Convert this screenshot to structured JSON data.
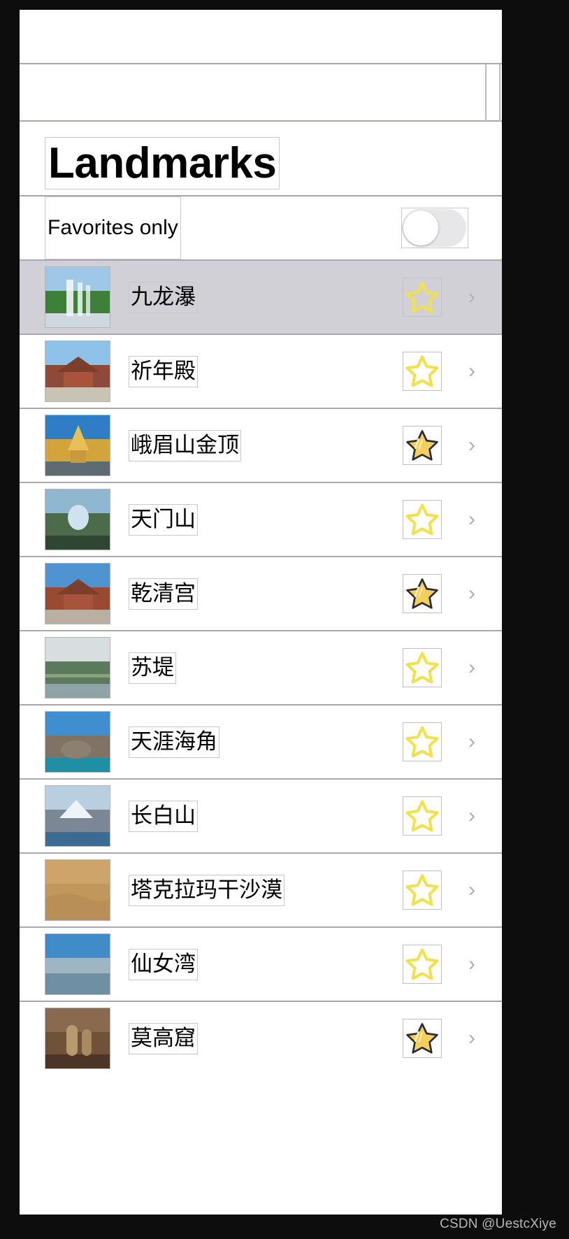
{
  "app": {
    "title": "Landmarks",
    "toolbar": {
      "status_bar": "",
      "nav_bar": ""
    }
  },
  "filter": {
    "label": "Favorites only",
    "toggle_state": "off"
  },
  "colors": {
    "selected_row": "#d0d0d6",
    "separator": "#a8a9b4",
    "star_outline": "#f2e14a",
    "star_filled": "#f3cf5e",
    "chevron": "#b0b0b0",
    "debug_border": "#c9c9c9"
  },
  "list": {
    "chevron_glyph": "›",
    "rows": [
      {
        "name": "九龙瀑",
        "favorite": false,
        "selected": true,
        "thumb": {
          "sky": "#9ec7e8",
          "mid": "#3e7f3a",
          "ground": "#cfd8dc",
          "kind": "waterfall"
        }
      },
      {
        "name": "祈年殿",
        "favorite": false,
        "selected": false,
        "thumb": {
          "sky": "#8fc2e8",
          "mid": "#8d4a3a",
          "ground": "#c9c3b4",
          "kind": "temple"
        }
      },
      {
        "name": "峨眉山金顶",
        "favorite": true,
        "selected": false,
        "thumb": {
          "sky": "#2f7dc4",
          "mid": "#d4a43c",
          "ground": "#5e6b72",
          "kind": "golden-summit"
        }
      },
      {
        "name": "天门山",
        "favorite": false,
        "selected": false,
        "thumb": {
          "sky": "#8fb7cf",
          "mid": "#4c6b4a",
          "ground": "#2f4632",
          "kind": "mountain-arch"
        }
      },
      {
        "name": "乾清宫",
        "favorite": true,
        "selected": false,
        "thumb": {
          "sky": "#4f93cf",
          "mid": "#9a4a33",
          "ground": "#b9b0a2",
          "kind": "palace"
        }
      },
      {
        "name": "苏堤",
        "favorite": false,
        "selected": false,
        "thumb": {
          "sky": "#d8dde0",
          "mid": "#5a7a5c",
          "ground": "#8fa3a8",
          "kind": "lake-causeway"
        }
      },
      {
        "name": "天涯海角",
        "favorite": false,
        "selected": false,
        "thumb": {
          "sky": "#3f8fd0",
          "mid": "#7e7365",
          "ground": "#1f8fa6",
          "kind": "seaside-rock"
        }
      },
      {
        "name": "长白山",
        "favorite": false,
        "selected": false,
        "thumb": {
          "sky": "#b9cede",
          "mid": "#7b8794",
          "ground": "#3a6c93",
          "kind": "snow-lake"
        }
      },
      {
        "name": "塔克拉玛干沙漠",
        "favorite": false,
        "selected": false,
        "thumb": {
          "sky": "#cfa46a",
          "mid": "#c2975c",
          "ground": "#8d6c45",
          "kind": "desert"
        }
      },
      {
        "name": "仙女湾",
        "favorite": false,
        "selected": false,
        "thumb": {
          "sky": "#3f8cc9",
          "mid": "#9fb5c2",
          "ground": "#7f9aa8",
          "kind": "bay"
        }
      },
      {
        "name": "莫高窟",
        "favorite": true,
        "selected": false,
        "thumb": {
          "sky": "#8a6a4e",
          "mid": "#6f5238",
          "ground": "#4a3526",
          "kind": "grotto"
        }
      }
    ]
  },
  "watermark": {
    "text": "CSDN @UestcXiye"
  }
}
